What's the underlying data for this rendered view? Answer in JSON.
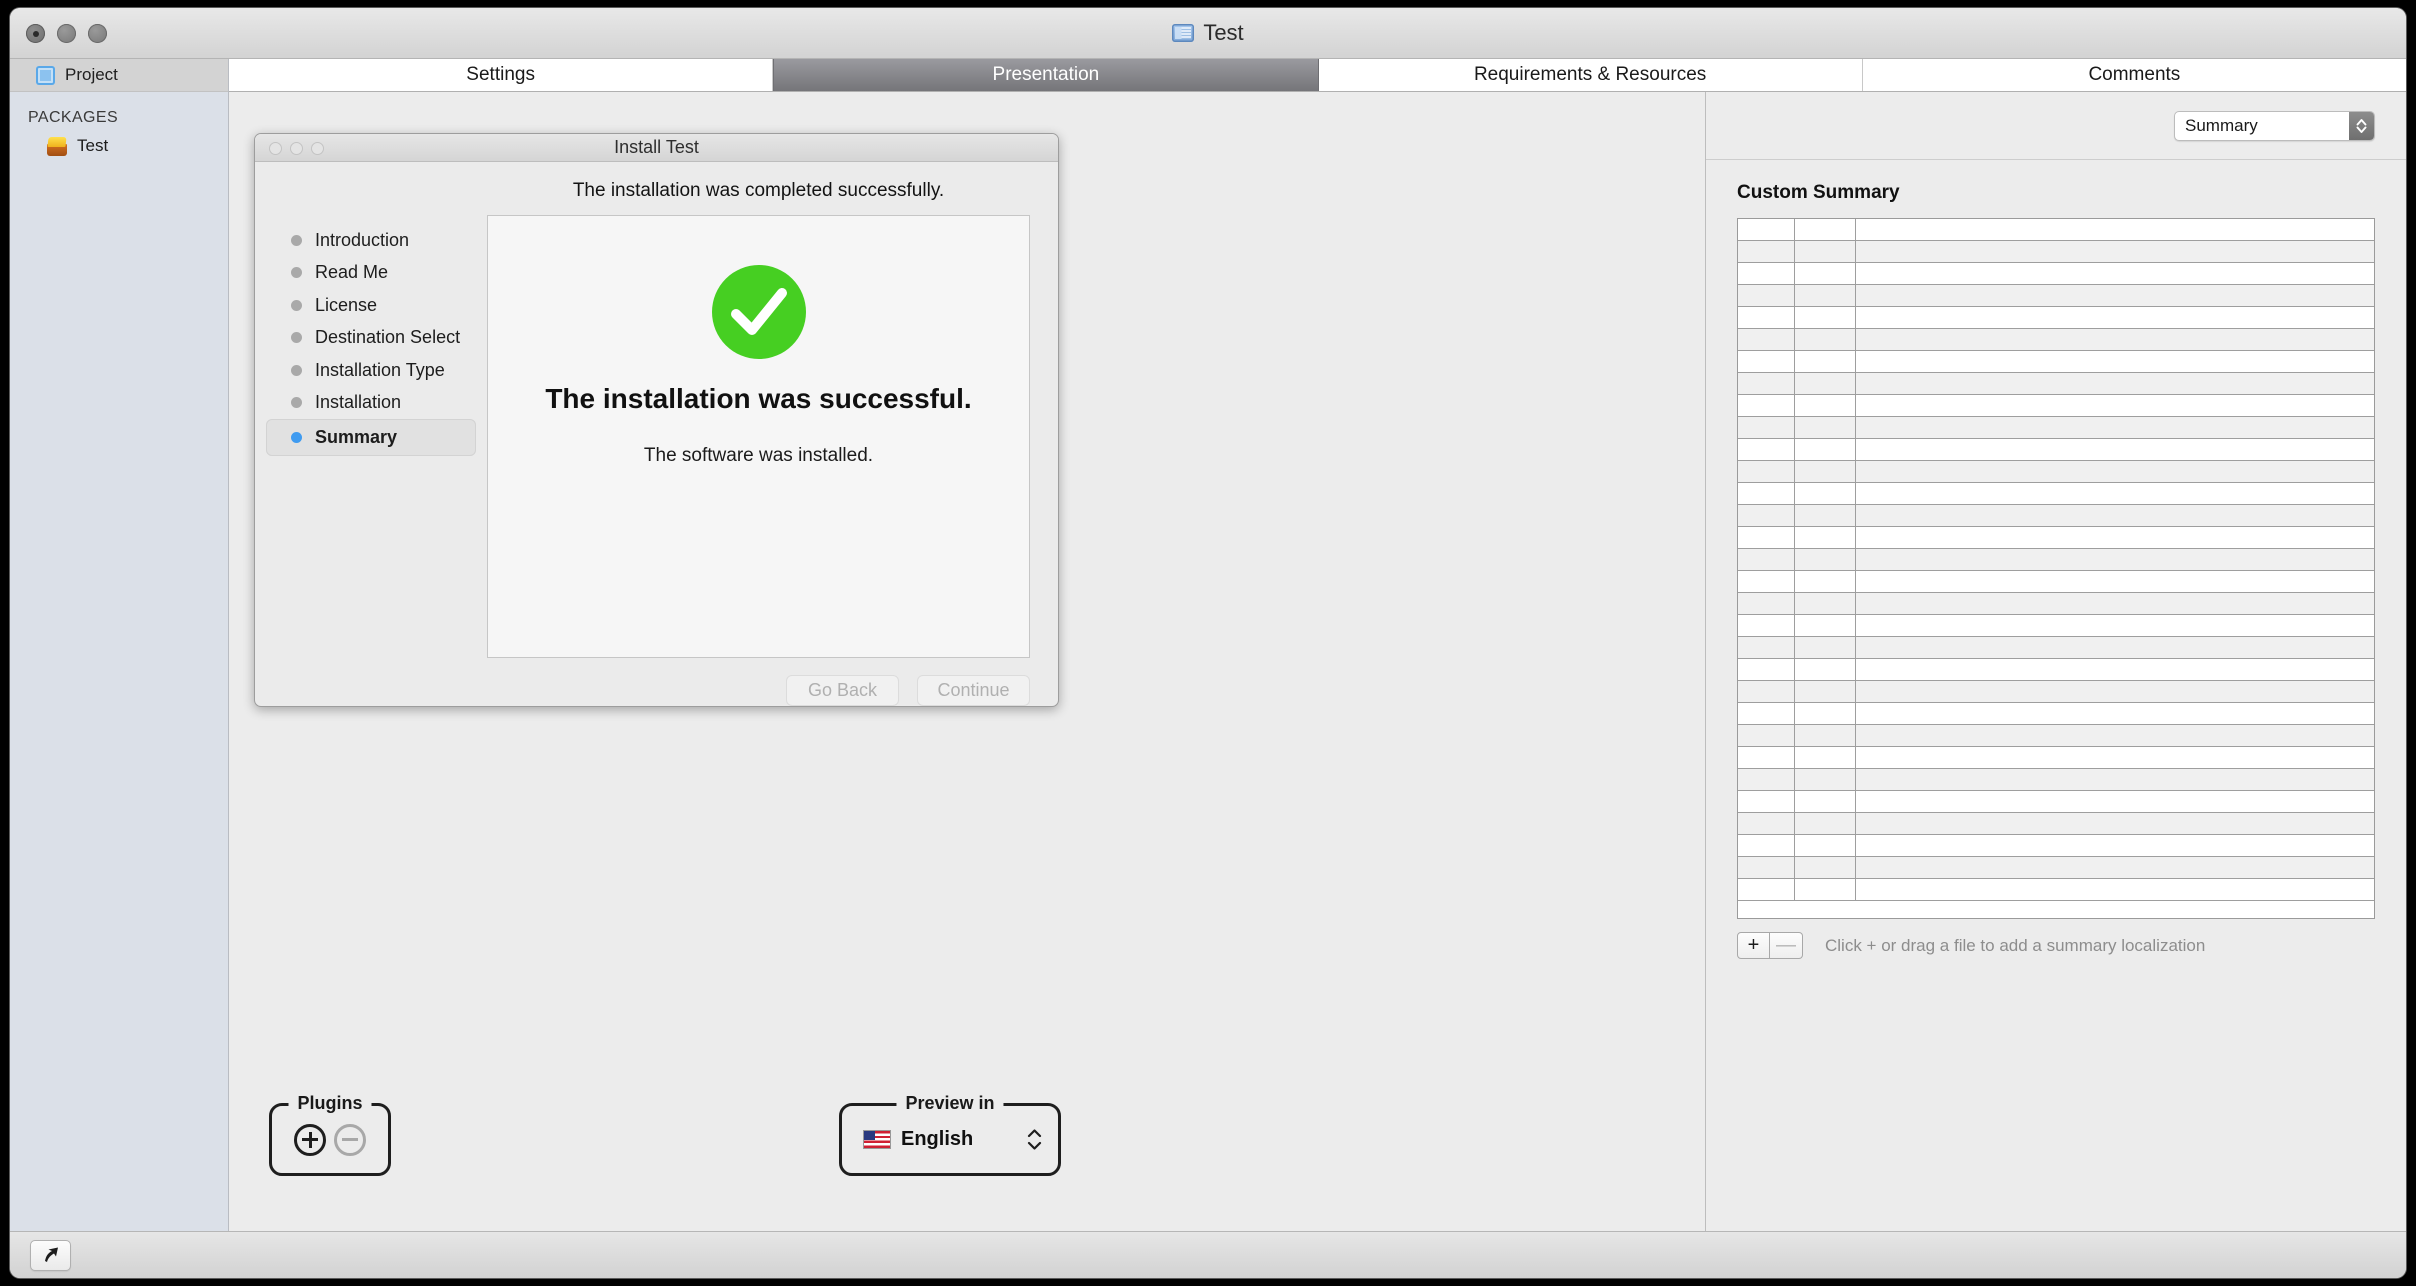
{
  "window": {
    "title": "Test",
    "doc_icon": "document-icon",
    "traffic_lights": [
      "close",
      "minimize",
      "maximize"
    ]
  },
  "sidebar": {
    "project_row": {
      "label": "Project",
      "icon": "project-icon"
    },
    "section_header": "PACKAGES",
    "items": [
      {
        "label": "Test",
        "icon": "package-icon"
      }
    ]
  },
  "tabs": [
    {
      "label": "Settings",
      "selected": false
    },
    {
      "label": "Presentation",
      "selected": true
    },
    {
      "label": "Requirements & Resources",
      "selected": false
    },
    {
      "label": "Comments",
      "selected": false
    }
  ],
  "installer_preview": {
    "title": "Install Test",
    "headline": "The installation was completed successfully.",
    "steps": [
      {
        "label": "Introduction",
        "current": false
      },
      {
        "label": "Read Me",
        "current": false
      },
      {
        "label": "License",
        "current": false
      },
      {
        "label": "Destination Select",
        "current": false
      },
      {
        "label": "Installation Type",
        "current": false
      },
      {
        "label": "Installation",
        "current": false
      },
      {
        "label": "Summary",
        "current": true
      }
    ],
    "success_icon": "green-check-circle-icon",
    "success_title": "The installation was successful.",
    "success_subtitle": "The software was installed.",
    "buttons": [
      {
        "label": "Go Back",
        "enabled": false
      },
      {
        "label": "Continue",
        "enabled": false
      }
    ]
  },
  "plugins": {
    "legend": "Plugins",
    "add_icon": "plus-circle-icon",
    "remove_icon": "minus-circle-icon"
  },
  "preview_in": {
    "legend": "Preview in",
    "language": "English",
    "flag_icon": "us-flag-icon",
    "stepper_icon": "up-down-chevron-icon"
  },
  "inspector": {
    "popup_value": "Summary",
    "popup_icon": "up-down-chevron-icon",
    "section_title": "Custom Summary",
    "table": {
      "columns": [
        "",
        "",
        ""
      ],
      "rows": [],
      "row_count": 31
    },
    "add_button": "+",
    "remove_button": "—",
    "hint": "Click + or drag a file to add a summary localization"
  },
  "statusbar": {
    "build_icon": "arrow-cursor-icon"
  },
  "colors": {
    "accent_blue": "#3f9bf0",
    "success_green": "#46cf22",
    "selected_tab": "#757579",
    "sidebar_bg": "#dbe0e8",
    "window_bg": "#ececec"
  }
}
